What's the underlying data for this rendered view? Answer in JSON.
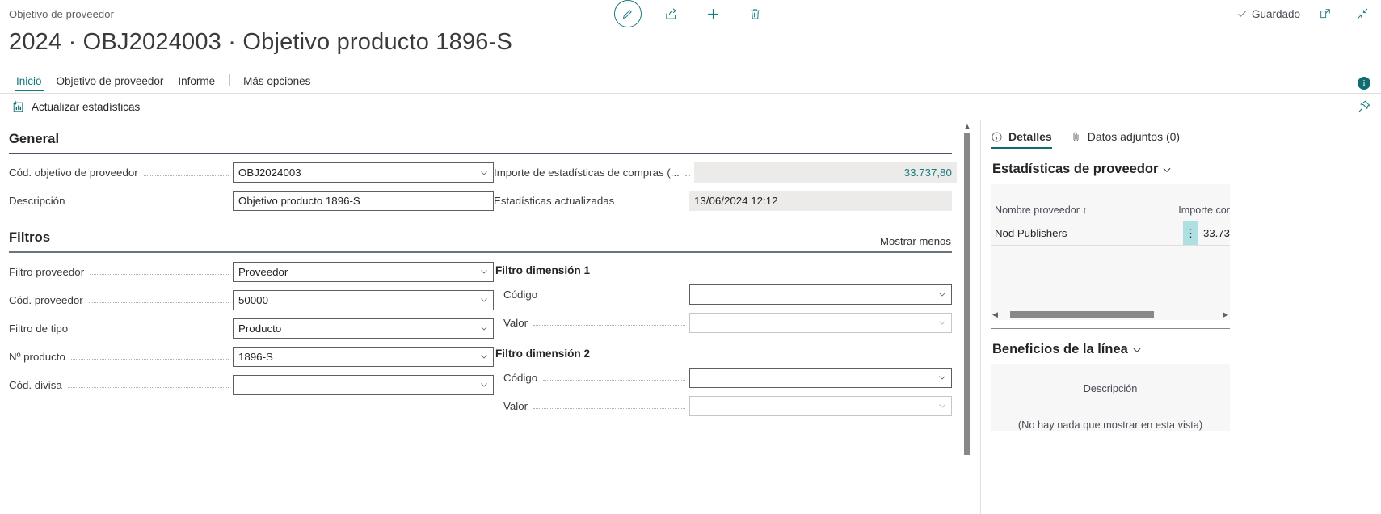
{
  "topbar": {
    "breadcrumb": "Objetivo de proveedor",
    "actions": [
      {
        "name": "edit-button",
        "icon": "pencil-icon",
        "label": "Editar"
      },
      {
        "name": "share-button",
        "icon": "share-icon",
        "label": "Compartir"
      },
      {
        "name": "new-button",
        "icon": "plus-icon",
        "label": "Nuevo"
      },
      {
        "name": "delete-button",
        "icon": "trash-icon",
        "label": "Eliminar"
      }
    ],
    "saved_label": "Guardado",
    "open_new_window_label": "Abrir en nueva ventana",
    "collapse_label": "Contraer"
  },
  "title": "2024 · OBJ2024003 · Objetivo producto 1896-S",
  "tabs": [
    {
      "label": "Inicio",
      "active": true
    },
    {
      "label": "Objetivo de proveedor",
      "active": false
    },
    {
      "label": "Informe",
      "active": false
    },
    {
      "label": "Más opciones",
      "active": false
    }
  ],
  "info_icon_label": "i",
  "actionbar": {
    "update_stats_label": "Actualizar estadísticas",
    "pin_label": "Anclar"
  },
  "general": {
    "heading": "General",
    "fields_left": [
      {
        "label": "Cód. objetivo de proveedor",
        "value": "OBJ2024003",
        "type": "lookup"
      },
      {
        "label": "Descripción",
        "value": "Objetivo producto 1896-S",
        "type": "text"
      }
    ],
    "fields_right": [
      {
        "label": "Importe de estadísticas de compras (...",
        "value": "33.737,80",
        "type": "readonly-number"
      },
      {
        "label": "Estadísticas actualizadas",
        "value": "13/06/2024 12:12",
        "type": "readonly"
      }
    ]
  },
  "filtros": {
    "heading": "Filtros",
    "show_less_label": "Mostrar menos",
    "fields_left": [
      {
        "label": "Filtro proveedor",
        "value": "Proveedor",
        "type": "select"
      },
      {
        "label": "Cód. proveedor",
        "value": "50000",
        "type": "lookup"
      },
      {
        "label": "Filtro de tipo",
        "value": "Producto",
        "type": "select"
      },
      {
        "label": "Nº producto",
        "value": "1896-S",
        "type": "lookup"
      },
      {
        "label": "Cód. divisa",
        "value": "",
        "type": "lookup"
      }
    ],
    "dimension1": {
      "heading": "Filtro dimensión 1",
      "fields": [
        {
          "label": "Código",
          "value": "",
          "type": "lookup"
        },
        {
          "label": "Valor",
          "value": "",
          "type": "lookup-dim"
        }
      ]
    },
    "dimension2": {
      "heading": "Filtro dimensión 2",
      "fields": [
        {
          "label": "Código",
          "value": "",
          "type": "lookup"
        },
        {
          "label": "Valor",
          "value": "",
          "type": "lookup-dim"
        }
      ]
    }
  },
  "factbox": {
    "tabs": [
      {
        "label": "Detalles",
        "icon": "info-circle-icon",
        "active": true
      },
      {
        "label": "Datos adjuntos (0)",
        "icon": "paperclip-icon",
        "active": false
      }
    ],
    "vendor_stats": {
      "title": "Estadísticas de proveedor",
      "columns": [
        "Nombre proveedor ↑",
        "Importe cor"
      ],
      "rows": [
        {
          "name": "Nod Publishers",
          "amount": "33.73"
        }
      ]
    },
    "line_benefits": {
      "title": "Beneficios de la línea",
      "column": "Descripción",
      "empty_message": "(No hay nada que mostrar en esta vista)"
    }
  },
  "colors": {
    "accent": "#1a7b7f",
    "tab_underline": "#0f6c70",
    "link": "#252423",
    "selection": "#aee0e2"
  }
}
